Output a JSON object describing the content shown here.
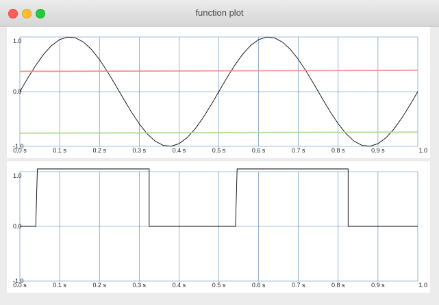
{
  "window": {
    "title": "function plot"
  },
  "colors": {
    "grid": "#4f7fb0",
    "curve": "#000000",
    "upper_bound": "#f08a84",
    "lower_bound": "#a9d98f"
  },
  "chart_data": [
    {
      "type": "line",
      "title": "",
      "xlabel": "",
      "ylabel": "",
      "xlim": [
        0,
        1.0
      ],
      "ylim": [
        -1.0,
        1.0
      ],
      "grid": true,
      "x_ticks": [
        0,
        0.1,
        0.2,
        0.3,
        0.4,
        0.5,
        0.6,
        0.7,
        0.8,
        0.9,
        1.0
      ],
      "x_tick_labels": [
        "0.0 s",
        "0.1 s",
        "0.2 s",
        "0.3 s",
        "0.4 s",
        "0.5 s",
        "0.6 s",
        "0.7 s",
        "0.8 s",
        "0.9 s",
        "1.0"
      ],
      "y_ticks": [
        -1.0,
        0.0,
        1.0
      ],
      "y_tick_labels": [
        "-1.0",
        "0.0",
        "1.0"
      ],
      "series": [
        {
          "color": "#000000",
          "x": [
            0,
            0.02,
            0.04,
            0.06,
            0.08,
            0.1,
            0.12,
            0.14,
            0.16,
            0.18,
            0.2,
            0.22,
            0.24,
            0.26,
            0.28,
            0.3,
            0.32,
            0.34,
            0.36,
            0.38,
            0.4,
            0.42,
            0.44,
            0.46,
            0.48,
            0.5,
            0.52,
            0.54,
            0.56,
            0.58,
            0.6,
            0.62,
            0.64,
            0.66,
            0.68,
            0.7,
            0.72,
            0.74,
            0.76,
            0.78,
            0.8,
            0.82,
            0.84,
            0.86,
            0.88,
            0.9,
            0.92,
            0.94,
            0.96,
            0.98,
            1.0
          ],
          "y": [
            0,
            0.249,
            0.482,
            0.685,
            0.844,
            0.951,
            0.998,
            0.982,
            0.905,
            0.771,
            0.588,
            0.368,
            0.125,
            -0.125,
            -0.368,
            -0.588,
            -0.771,
            -0.905,
            -0.982,
            -0.998,
            -0.951,
            -0.844,
            -0.685,
            -0.482,
            -0.249,
            0,
            0.249,
            0.482,
            0.685,
            0.844,
            0.951,
            0.998,
            0.982,
            0.905,
            0.771,
            0.588,
            0.368,
            0.125,
            -0.125,
            -0.368,
            -0.588,
            -0.771,
            -0.905,
            -0.982,
            -0.998,
            -0.951,
            -0.844,
            -0.685,
            -0.482,
            -0.249,
            0
          ]
        },
        {
          "color": "#f08a84",
          "x": [
            0,
            1.0
          ],
          "y": [
            0.37,
            0.39
          ]
        },
        {
          "color": "#a9d98f",
          "x": [
            0,
            1.0
          ],
          "y": [
            -0.76,
            -0.74
          ]
        }
      ]
    },
    {
      "type": "line",
      "title": "",
      "xlabel": "",
      "ylabel": "",
      "xlim": [
        0,
        1.0
      ],
      "ylim": [
        -1.0,
        1.0
      ],
      "grid": true,
      "x_ticks": [
        0,
        0.1,
        0.2,
        0.3,
        0.4,
        0.5,
        0.6,
        0.7,
        0.8,
        0.9,
        1.0
      ],
      "x_tick_labels": [
        "0.0 s",
        "0.1 s",
        "0.2 s",
        "0.3 s",
        "0.4 s",
        "0.5 s",
        "0.6 s",
        "0.7 s",
        "0.8 s",
        "0.9 s",
        "1.0"
      ],
      "y_ticks": [
        -1.0,
        0.0,
        1.0
      ],
      "y_tick_labels": [
        "-1.0",
        "0.0",
        "1.0"
      ],
      "series": [
        {
          "color": "#000000",
          "x": [
            0,
            0.04,
            0.044,
            0.325,
            0.325,
            0.542,
            0.546,
            0.825,
            0.825,
            1.0
          ],
          "y": [
            0,
            0,
            1.05,
            1.05,
            0,
            0,
            1.05,
            1.05,
            0,
            0
          ]
        }
      ]
    }
  ]
}
